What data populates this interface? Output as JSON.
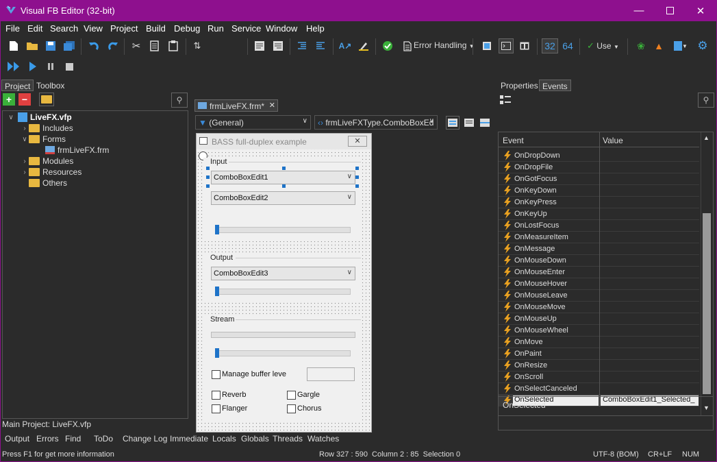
{
  "window": {
    "title": "Visual FB Editor (32-bit)"
  },
  "menu": [
    "File",
    "Edit",
    "Search",
    "View",
    "Project",
    "Build",
    "Debug",
    "Run",
    "Service",
    "Window",
    "Help"
  ],
  "toolbar": {
    "error_handling_label": "Error Handling",
    "bits32_label": "32",
    "bits64_label": "64",
    "use_label": "Use"
  },
  "left_panel": {
    "tabs": [
      "Project",
      "Toolbox"
    ],
    "tree": {
      "root": "LiveFX.vfp",
      "includes": "Includes",
      "forms": "Forms",
      "form_file": "frmLiveFX.frm",
      "modules": "Modules",
      "resources": "Resources",
      "others": "Others"
    },
    "main_project": "Main Project: LiveFX.vfp"
  },
  "editor": {
    "tab_label": "frmLiveFX.frm*",
    "general_combo": "(General)",
    "type_combo": "frmLiveFXType.ComboBoxEd",
    "form": {
      "title": "BASS full-duplex example",
      "input_group": "Input",
      "combo1": "ComboBoxEdit1",
      "combo2": "ComboBoxEdit2",
      "output_group": "Output",
      "combo3": "ComboBoxEdit3",
      "stream_group": "Stream",
      "manage_buffer": "Manage buffer leve",
      "reverb": "Reverb",
      "gargle": "Gargle",
      "flanger": "Flanger",
      "chorus": "Chorus"
    }
  },
  "right_panel": {
    "tabs": [
      "Properties",
      "Events"
    ],
    "col_event": "Event",
    "col_value": "Value",
    "events": [
      {
        "name": "OnDropDown",
        "value": ""
      },
      {
        "name": "OnDropFile",
        "value": ""
      },
      {
        "name": "OnGotFocus",
        "value": ""
      },
      {
        "name": "OnKeyDown",
        "value": ""
      },
      {
        "name": "OnKeyPress",
        "value": ""
      },
      {
        "name": "OnKeyUp",
        "value": ""
      },
      {
        "name": "OnLostFocus",
        "value": ""
      },
      {
        "name": "OnMeasureItem",
        "value": ""
      },
      {
        "name": "OnMessage",
        "value": ""
      },
      {
        "name": "OnMouseDown",
        "value": ""
      },
      {
        "name": "OnMouseEnter",
        "value": ""
      },
      {
        "name": "OnMouseHover",
        "value": ""
      },
      {
        "name": "OnMouseLeave",
        "value": ""
      },
      {
        "name": "OnMouseMove",
        "value": ""
      },
      {
        "name": "OnMouseUp",
        "value": ""
      },
      {
        "name": "OnMouseWheel",
        "value": ""
      },
      {
        "name": "OnMove",
        "value": ""
      },
      {
        "name": "OnPaint",
        "value": ""
      },
      {
        "name": "OnResize",
        "value": ""
      },
      {
        "name": "OnScroll",
        "value": ""
      },
      {
        "name": "OnSelectCanceled",
        "value": ""
      },
      {
        "name": "OnSelected",
        "value": "ComboBoxEdit1_Selected_"
      }
    ],
    "description": "OnSelected"
  },
  "bottom_tabs": [
    "Output",
    "Errors",
    "Find",
    "ToDo",
    "Change Log",
    "Immediate",
    "Locals",
    "Globals",
    "Threads",
    "Watches"
  ],
  "status": {
    "hint": "Press F1 for get more information",
    "position": "Row 327 : 590  Column 2 : 85  Selection 0",
    "encoding": "UTF-8 (BOM)",
    "line_end": "CR+LF",
    "num": "NUM"
  },
  "colors": {
    "titlebar": "#8e108e",
    "background": "#2b2b2b",
    "accent": "#1e73c8"
  }
}
